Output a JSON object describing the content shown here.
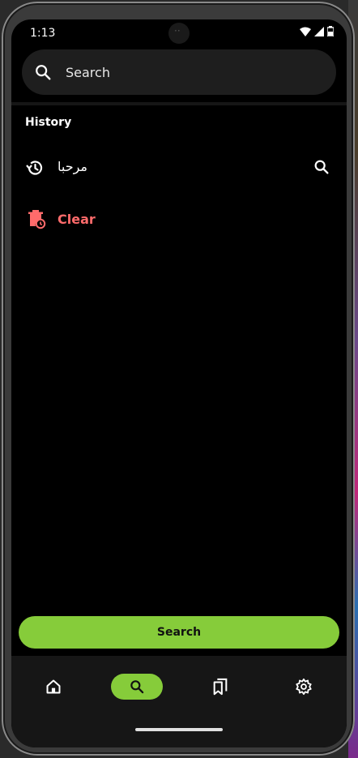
{
  "status_bar": {
    "time": "1:13"
  },
  "search_bar": {
    "placeholder": "Search"
  },
  "history": {
    "label": "History",
    "items": [
      {
        "text": "مرحبا"
      }
    ],
    "clear_label": "Clear"
  },
  "search_button": {
    "label": "Search"
  },
  "bottom_nav": {
    "items": [
      {
        "icon": "home-icon",
        "active": false
      },
      {
        "icon": "search-icon",
        "active": true
      },
      {
        "icon": "library-icon",
        "active": false
      },
      {
        "icon": "settings-icon",
        "active": false
      }
    ]
  },
  "colors": {
    "accent": "#86cc3a",
    "danger": "#ff6b6b",
    "background": "#000000",
    "surface": "#1e1e1e"
  }
}
